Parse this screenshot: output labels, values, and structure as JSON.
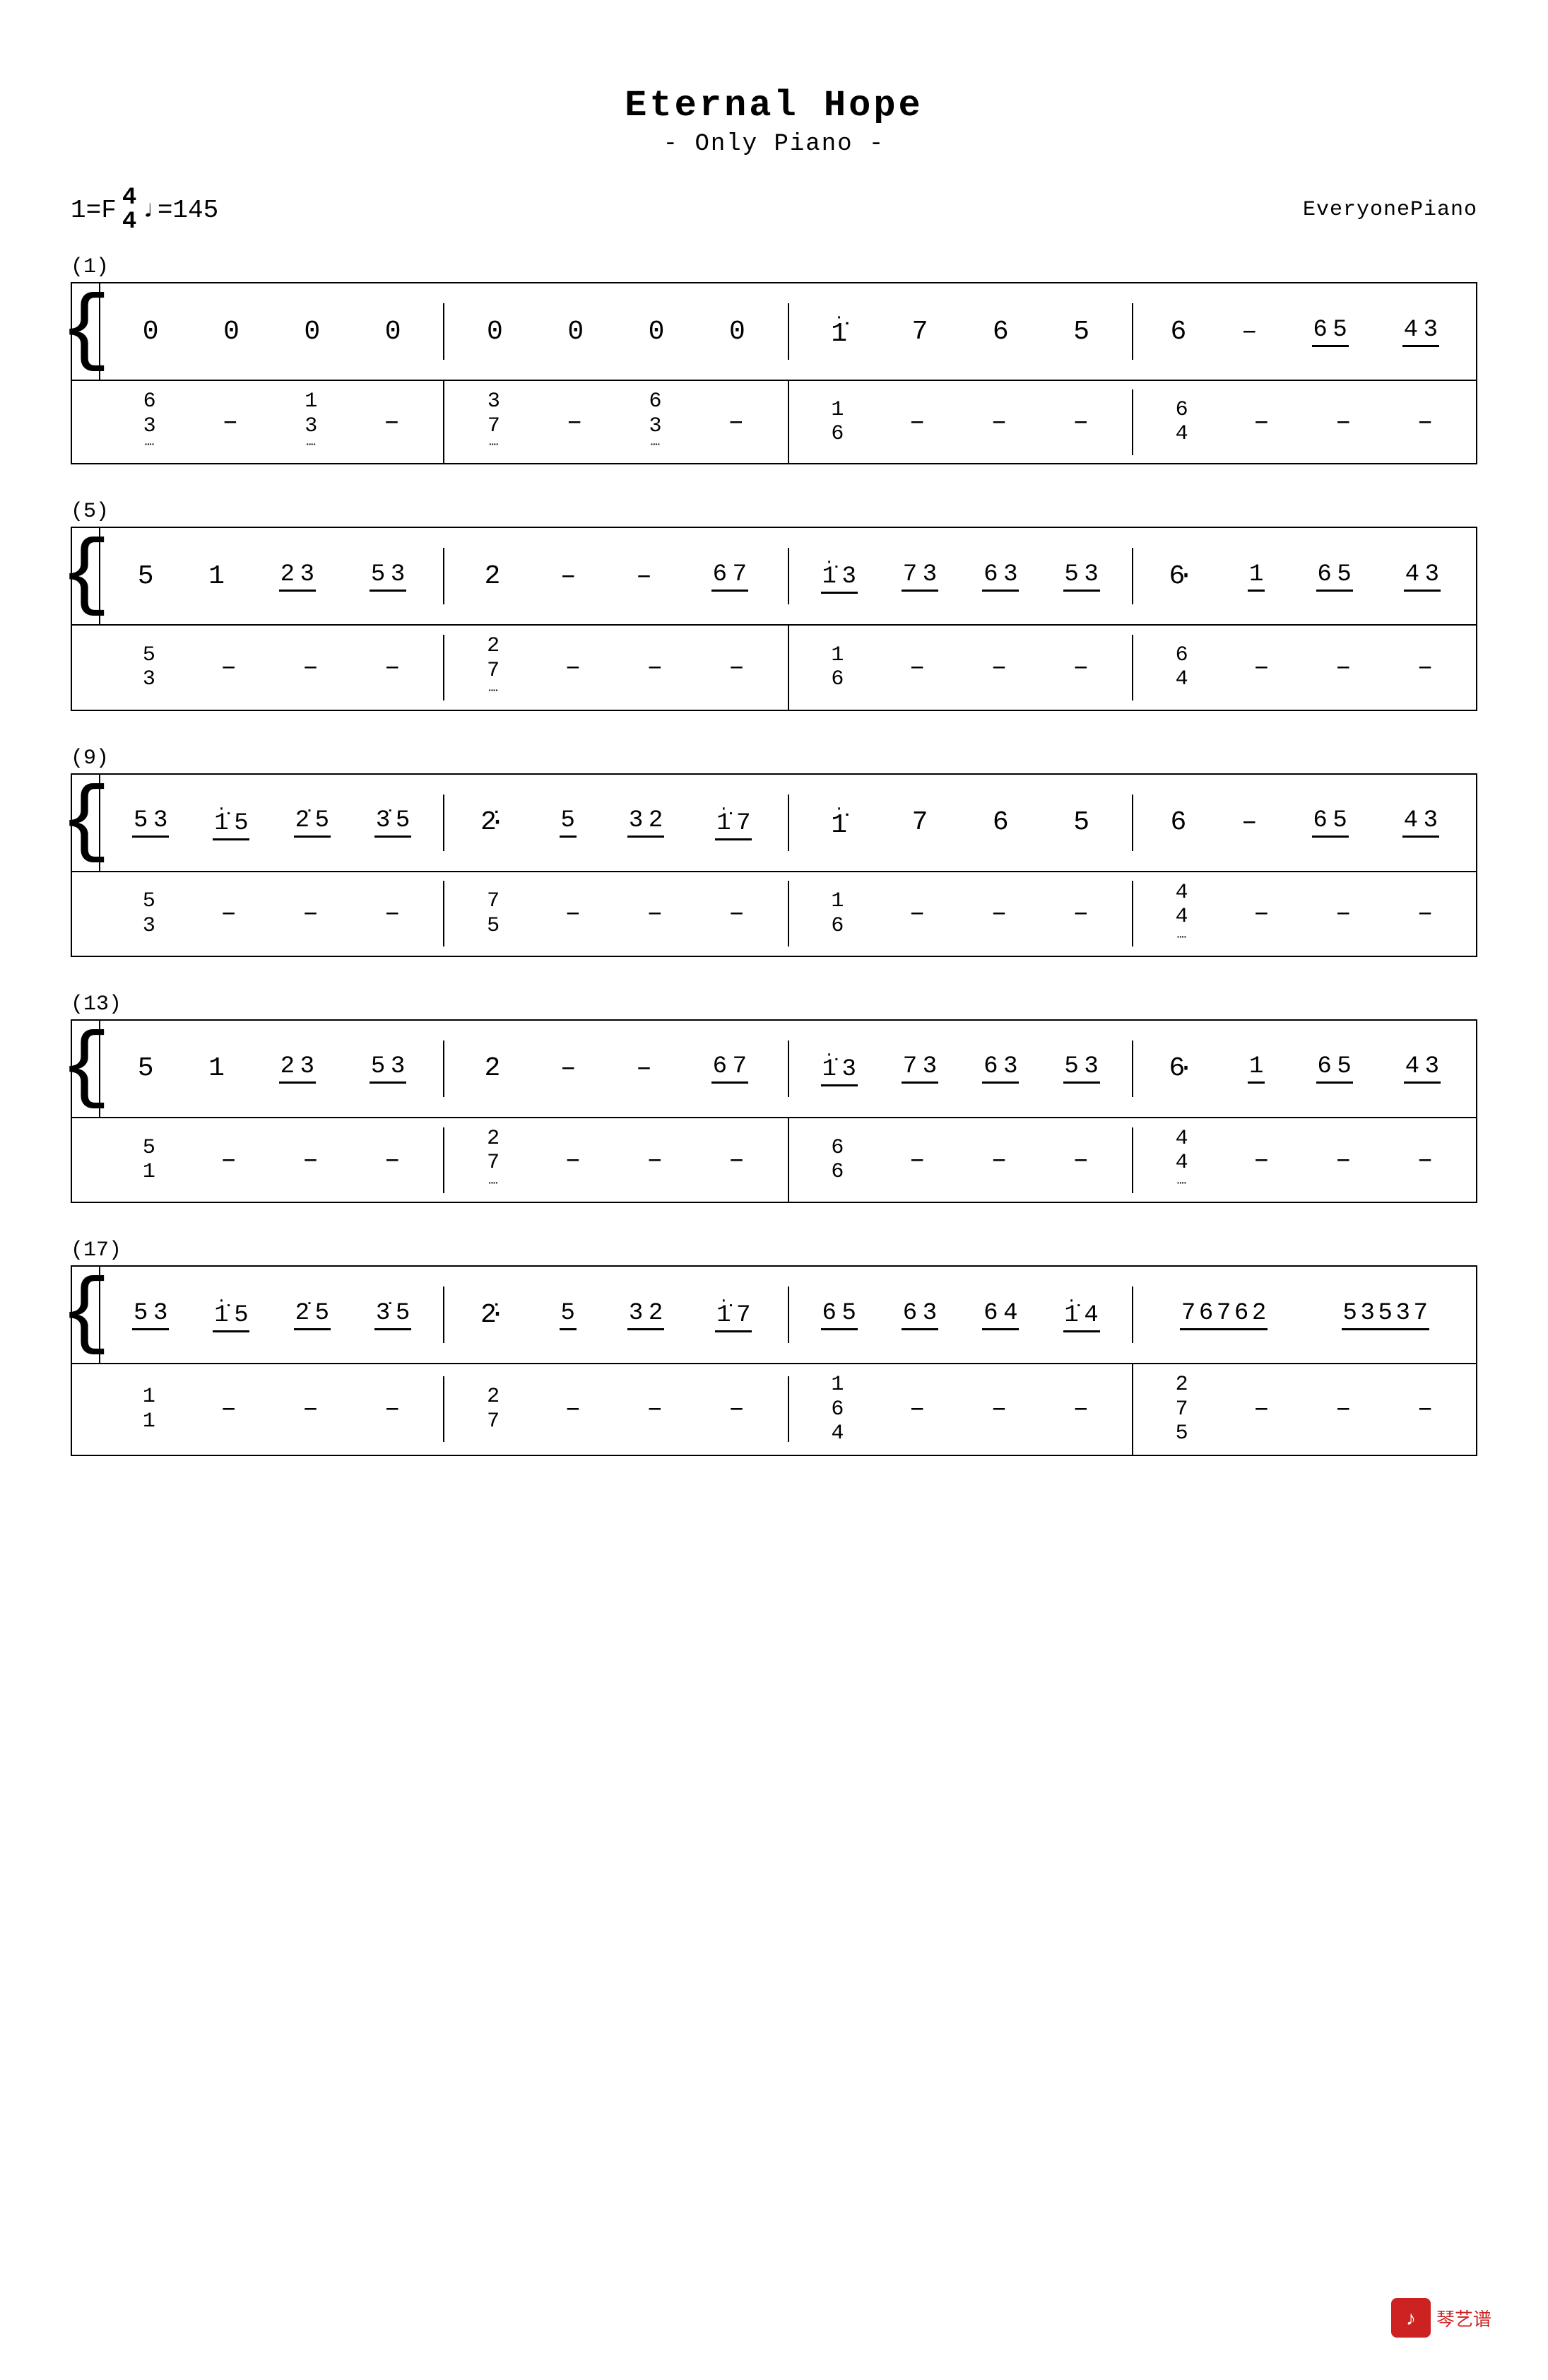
{
  "title": {
    "main": "Eternal Hope",
    "sub": "- Only Piano -"
  },
  "meta": {
    "key": "1=F",
    "time_num": "4",
    "time_den": "4",
    "tempo": "♩=145",
    "brand": "EveryonePiano"
  },
  "sections": [
    {
      "number": "(1)",
      "treble": [
        [
          "0",
          "0",
          "0",
          "0"
        ],
        [
          "0",
          "0",
          "0",
          "0"
        ],
        [
          "İ",
          "7",
          "6",
          "5"
        ],
        [
          "6",
          "–",
          "6̲5̲",
          "4̲3̲"
        ]
      ],
      "bass": [
        [
          "6/3/⁻",
          "–",
          "1/3/⁻",
          "–"
        ],
        [
          "3/7/⁻",
          "–",
          "6/3/⁻",
          "–"
        ],
        [
          "1/6",
          "–",
          "–",
          "–"
        ],
        [
          "6/4",
          "–",
          "–",
          "–"
        ]
      ]
    },
    {
      "number": "(5)",
      "treble": [
        [
          "5",
          "1",
          "2̲3̲",
          "5̲3̲"
        ],
        [
          "2",
          "–",
          "–",
          "6̲7̲"
        ],
        [
          "İ̲3̲",
          "7̲3̲",
          "6̲3̲",
          "5̲3̲"
        ],
        [
          "6·",
          "1̲",
          "6̲5̲",
          "4̲3̲"
        ]
      ],
      "bass": [
        [
          "5/3",
          "–",
          "–",
          "–"
        ],
        [
          "2/7/⁻",
          "–",
          "–",
          "–"
        ],
        [
          "1/6",
          "–",
          "–",
          "–"
        ],
        [
          "6/4",
          "–",
          "–",
          "–"
        ]
      ]
    },
    {
      "number": "(9)",
      "treble": [
        [
          "5̲3̲",
          "İ̲5̲",
          "2̲5̲",
          "3̲5̲"
        ],
        [
          "2·",
          "5̲",
          "3̲2̲",
          "İ̲7̲"
        ],
        [
          "İ",
          "7",
          "6",
          "5"
        ],
        [
          "6",
          "–",
          "6̲5̲",
          "4̲3̲"
        ]
      ],
      "bass": [
        [
          "5/3",
          "–",
          "–",
          "–"
        ],
        [
          "7/5",
          "–",
          "–",
          "–"
        ],
        [
          "1/6",
          "–",
          "–",
          "–"
        ],
        [
          "4/4",
          "–",
          "–",
          "–"
        ]
      ]
    },
    {
      "number": "(13)",
      "treble": [
        [
          "5",
          "1",
          "2̲3̲",
          "5̲3̲"
        ],
        [
          "2",
          "–",
          "–",
          "6̲7̲"
        ],
        [
          "İ̲3̲",
          "7̲3̲",
          "6̲3̲",
          "5̲3̲"
        ],
        [
          "6·",
          "1̲",
          "6̲5̲",
          "4̲3̲"
        ]
      ],
      "bass": [
        [
          "5/1",
          "–",
          "–",
          "–"
        ],
        [
          "2/7/⁻",
          "–",
          "–",
          "–"
        ],
        [
          "6/6",
          "–",
          "–",
          "–"
        ],
        [
          "4/4",
          "–",
          "–",
          "–"
        ]
      ]
    },
    {
      "number": "(17)",
      "treble": [
        [
          "5̲3̲",
          "İ̲5̲",
          "2̲5̲",
          "3̲5̲"
        ],
        [
          "2·",
          "5̲",
          "3̲2̲",
          "İ̲7̲"
        ],
        [
          "6̲5̲",
          "6̲3̲",
          "6̲4̲",
          "İ̲4̲"
        ],
        [
          "7̲6̲7̲6̲2̲",
          "5̲3̲5̲3̲7̲"
        ]
      ],
      "bass": [
        [
          "1/1",
          "–",
          "–",
          "–"
        ],
        [
          "2/7",
          "–",
          "–",
          "–"
        ],
        [
          "1/6/4",
          "–",
          "–",
          "–"
        ],
        [
          "2/7/5",
          "–",
          "–",
          "–"
        ]
      ]
    }
  ]
}
